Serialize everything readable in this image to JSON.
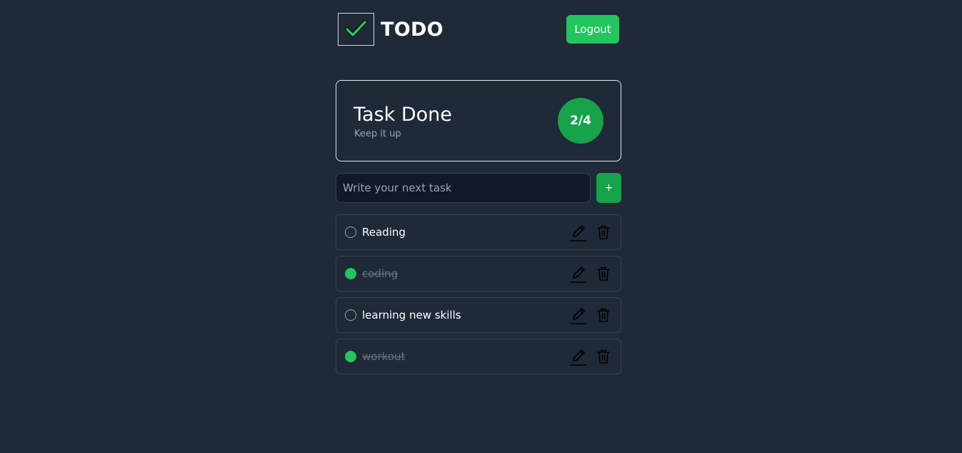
{
  "header": {
    "brand": "TODO",
    "logout_label": "Logout",
    "logo_icon": "checkmark-icon"
  },
  "summary": {
    "title": "Task Done",
    "subtitle": "Keep it up",
    "counter": "2/4"
  },
  "new_task": {
    "placeholder": "Write your next task",
    "value": "",
    "add_label": "+"
  },
  "tasks": [
    {
      "label": "Reading",
      "done": false
    },
    {
      "label": "coding",
      "done": true
    },
    {
      "label": "learning new skills",
      "done": false
    },
    {
      "label": "workout",
      "done": true
    }
  ],
  "colors": {
    "background": "#1f2937",
    "accent": "#22c55e",
    "accent_dark": "#16a34a",
    "muted_text": "#9ca3af"
  }
}
